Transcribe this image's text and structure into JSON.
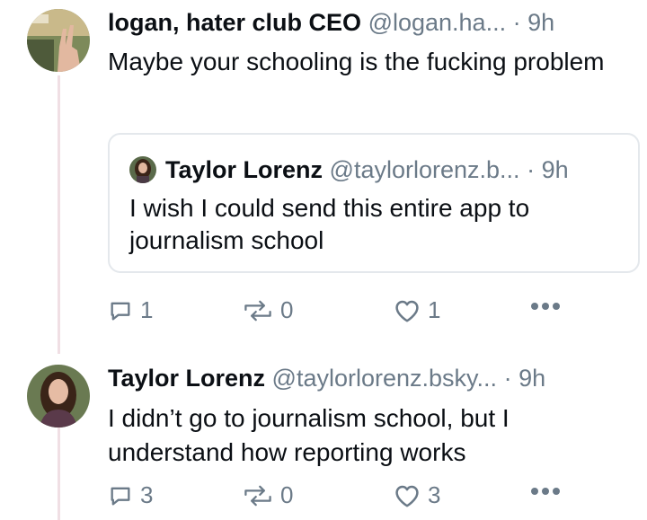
{
  "post1": {
    "display_name": "logan, hater club CEO",
    "handle": "@logan.ha...",
    "separator": "·",
    "time": "9h",
    "text": "Maybe your schooling is the fucking problem",
    "quote": {
      "display_name": "Taylor Lorenz",
      "handle": "@taylorlorenz.b...",
      "separator": "·",
      "time": "9h",
      "text": "I wish I could send this entire app to journalism school"
    },
    "actions": {
      "replies": "1",
      "reposts": "0",
      "likes": "1"
    }
  },
  "post2": {
    "display_name": "Taylor Lorenz",
    "handle": "@taylorlorenz.bsky...",
    "separator": "·",
    "time": "9h",
    "text": "I didn’t go to journalism school, but I understand how reporting works",
    "actions": {
      "replies": "3",
      "reposts": "0",
      "likes": "3"
    }
  },
  "colors": {
    "muted": "#6b7a88",
    "thread_line": "#f0dfe4",
    "border": "#e4e8ec"
  },
  "icons": [
    "reply-icon",
    "repost-icon",
    "like-icon",
    "more-icon"
  ]
}
